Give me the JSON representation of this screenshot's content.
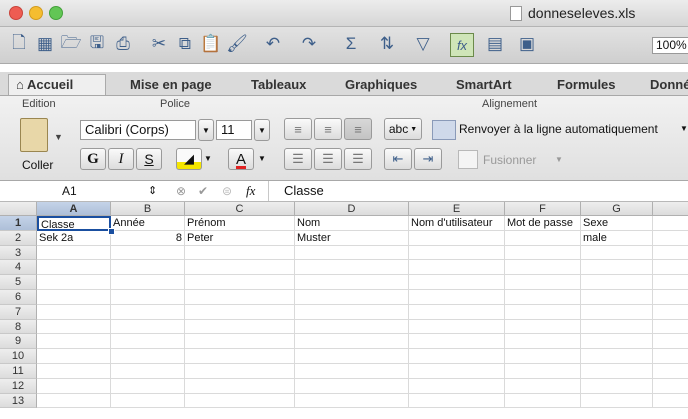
{
  "window": {
    "title": "donneseleves.xls"
  },
  "toolbar": {
    "zoom": "100%"
  },
  "tabs": [
    "Accueil",
    "Mise en page",
    "Tableaux",
    "Graphiques",
    "SmartArt",
    "Formules",
    "Donné"
  ],
  "ribbon": {
    "groups": {
      "edition": "Edition",
      "police": "Police",
      "alignement": "Alignement"
    },
    "font_name": "Calibri (Corps)",
    "font_size": "11",
    "paste_label": "Coller",
    "bold": "G",
    "italic": "I",
    "underline": "S",
    "font_color": "A",
    "abc": "abc",
    "wrap_label": "Renvoyer à la ligne automatiquement",
    "merge_label": "Fusionner"
  },
  "formula_bar": {
    "cell_ref": "A1",
    "fx": "fx",
    "value": "Classe"
  },
  "columns": [
    "A",
    "B",
    "C",
    "D",
    "E",
    "F",
    "G"
  ],
  "rows": [
    [
      "Classe",
      "Année",
      "Prénom",
      "Nom",
      "Nom d'utilisateur",
      "Mot de passe",
      "Sexe"
    ],
    [
      "Sek 2a",
      "8",
      "Peter",
      "Muster",
      "",
      "",
      "male"
    ],
    [
      "",
      "",
      "",
      "",
      "",
      "",
      ""
    ],
    [
      "",
      "",
      "",
      "",
      "",
      "",
      ""
    ],
    [
      "",
      "",
      "",
      "",
      "",
      "",
      ""
    ],
    [
      "",
      "",
      "",
      "",
      "",
      "",
      ""
    ],
    [
      "",
      "",
      "",
      "",
      "",
      "",
      ""
    ],
    [
      "",
      "",
      "",
      "",
      "",
      "",
      ""
    ],
    [
      "",
      "",
      "",
      "",
      "",
      "",
      ""
    ],
    [
      "",
      "",
      "",
      "",
      "",
      "",
      ""
    ],
    [
      "",
      "",
      "",
      "",
      "",
      "",
      ""
    ],
    [
      "",
      "",
      "",
      "",
      "",
      "",
      ""
    ],
    [
      "",
      "",
      "",
      "",
      "",
      "",
      ""
    ]
  ],
  "row_numbers": [
    "1",
    "2",
    "3",
    "4",
    "5",
    "6",
    "7",
    "8",
    "9",
    "10",
    "11",
    "12",
    "13"
  ],
  "colors": {
    "accent": "#3e5f8a",
    "selection": "#1a4fa0"
  }
}
